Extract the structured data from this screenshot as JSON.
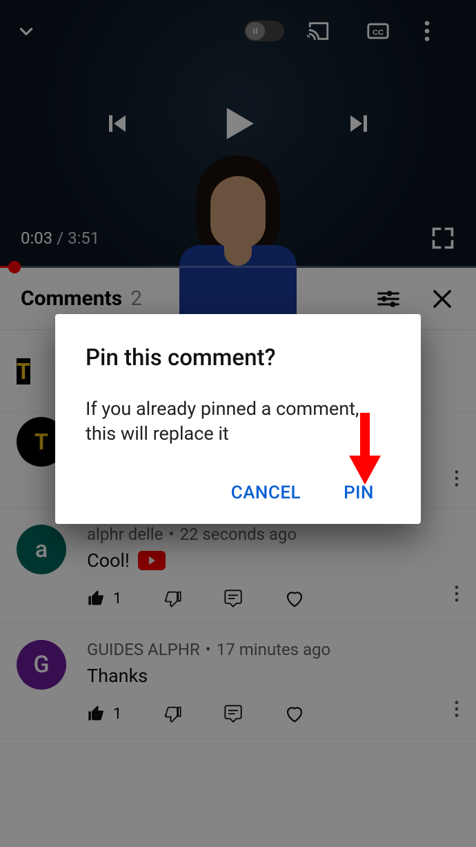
{
  "video": {
    "current_time": "0:03",
    "duration": "3:51"
  },
  "comments_header": {
    "title": "Comments",
    "count": "2"
  },
  "comments": [
    {
      "author": "alphr delle",
      "time": "22 seconds ago",
      "text": "Cool!",
      "likes": "1",
      "avatar_letter": "a"
    },
    {
      "author": "GUIDES ALPHR",
      "time": "17 minutes ago",
      "text": "Thanks",
      "likes": "1",
      "avatar_letter": "G"
    }
  ],
  "dialog": {
    "title": "Pin this comment?",
    "message": "If you already pinned a comment, this will replace it",
    "cancel": "CANCEL",
    "confirm": "PIN"
  }
}
